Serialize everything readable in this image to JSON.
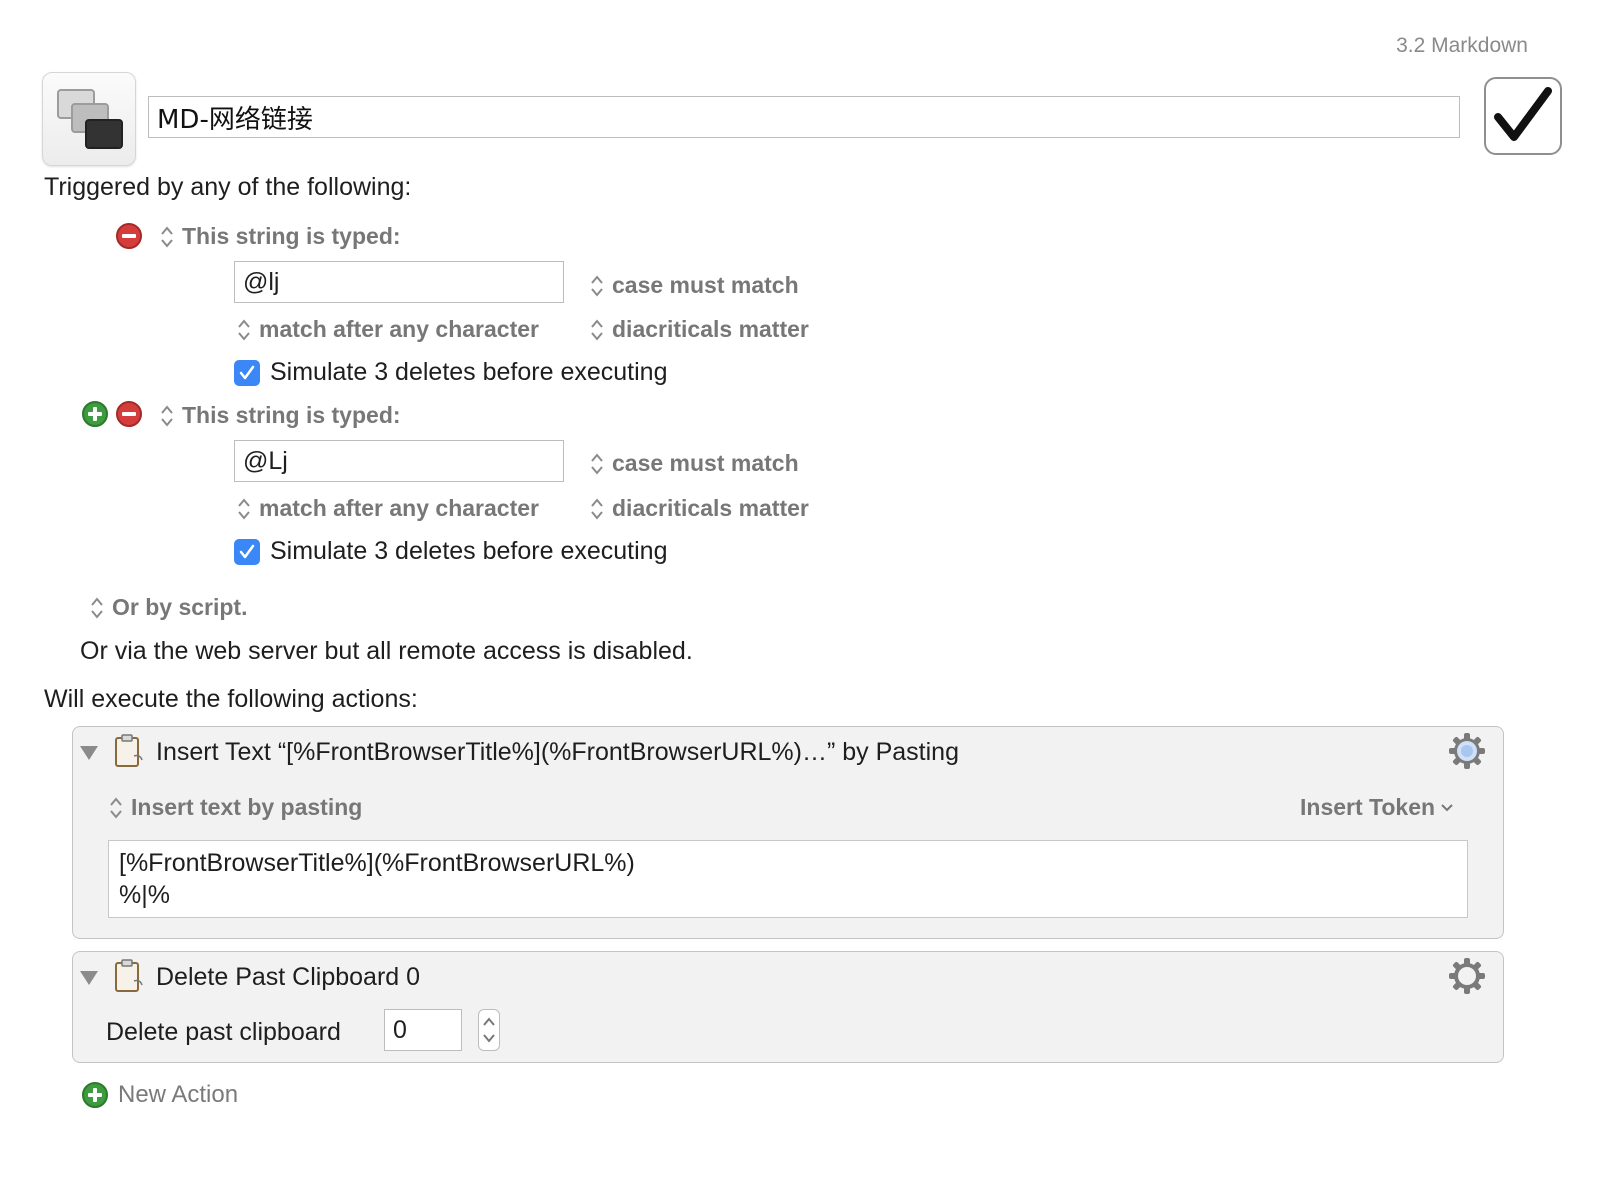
{
  "macro": {
    "group": "3.2 Markdown",
    "name": "MD-网络链接",
    "enabled": true
  },
  "triggers": {
    "heading": "Triggered by any of the following:",
    "items": [
      {
        "type_label": "This string is typed:",
        "string": "@lj",
        "case_option": "case must match",
        "match_option": "match after any character",
        "diacritics_option": "diacriticals matter",
        "simulate_label": "Simulate 3 deletes before executing",
        "simulate_checked": true
      },
      {
        "type_label": "This string is typed:",
        "string": "@Lj",
        "case_option": "case must match",
        "match_option": "match after any character",
        "diacritics_option": "diacriticals matter",
        "simulate_label": "Simulate 3 deletes before executing",
        "simulate_checked": true
      }
    ],
    "script_label": "Or by script.",
    "web_server_text": "Or via the web server but all remote access is disabled."
  },
  "actions": {
    "heading": "Will execute the following actions:",
    "items": [
      {
        "title": "Insert Text “[%FrontBrowserTitle%](%FrontBrowserURL%)…” by Pasting",
        "mode_label": "Insert text by pasting",
        "insert_token_label": "Insert Token",
        "content": "[%FrontBrowserTitle%](%FrontBrowserURL%)\n%|%"
      },
      {
        "title": "Delete Past Clipboard 0",
        "field_label": "Delete past clipboard",
        "value": "0"
      }
    ],
    "new_action_label": "New Action"
  },
  "icons": [
    "macro-icon",
    "checkmark-icon",
    "remove-icon",
    "add-icon",
    "updown-arrows-icon",
    "disclosure-triangle-icon",
    "clipboard-icon",
    "gear-icon",
    "chevron-down-icon"
  ],
  "colors": {
    "remove": "#d53d3d",
    "add": "#3f9b3f",
    "checkbox": "#3b87f5",
    "panel": "#f2f2f2"
  }
}
